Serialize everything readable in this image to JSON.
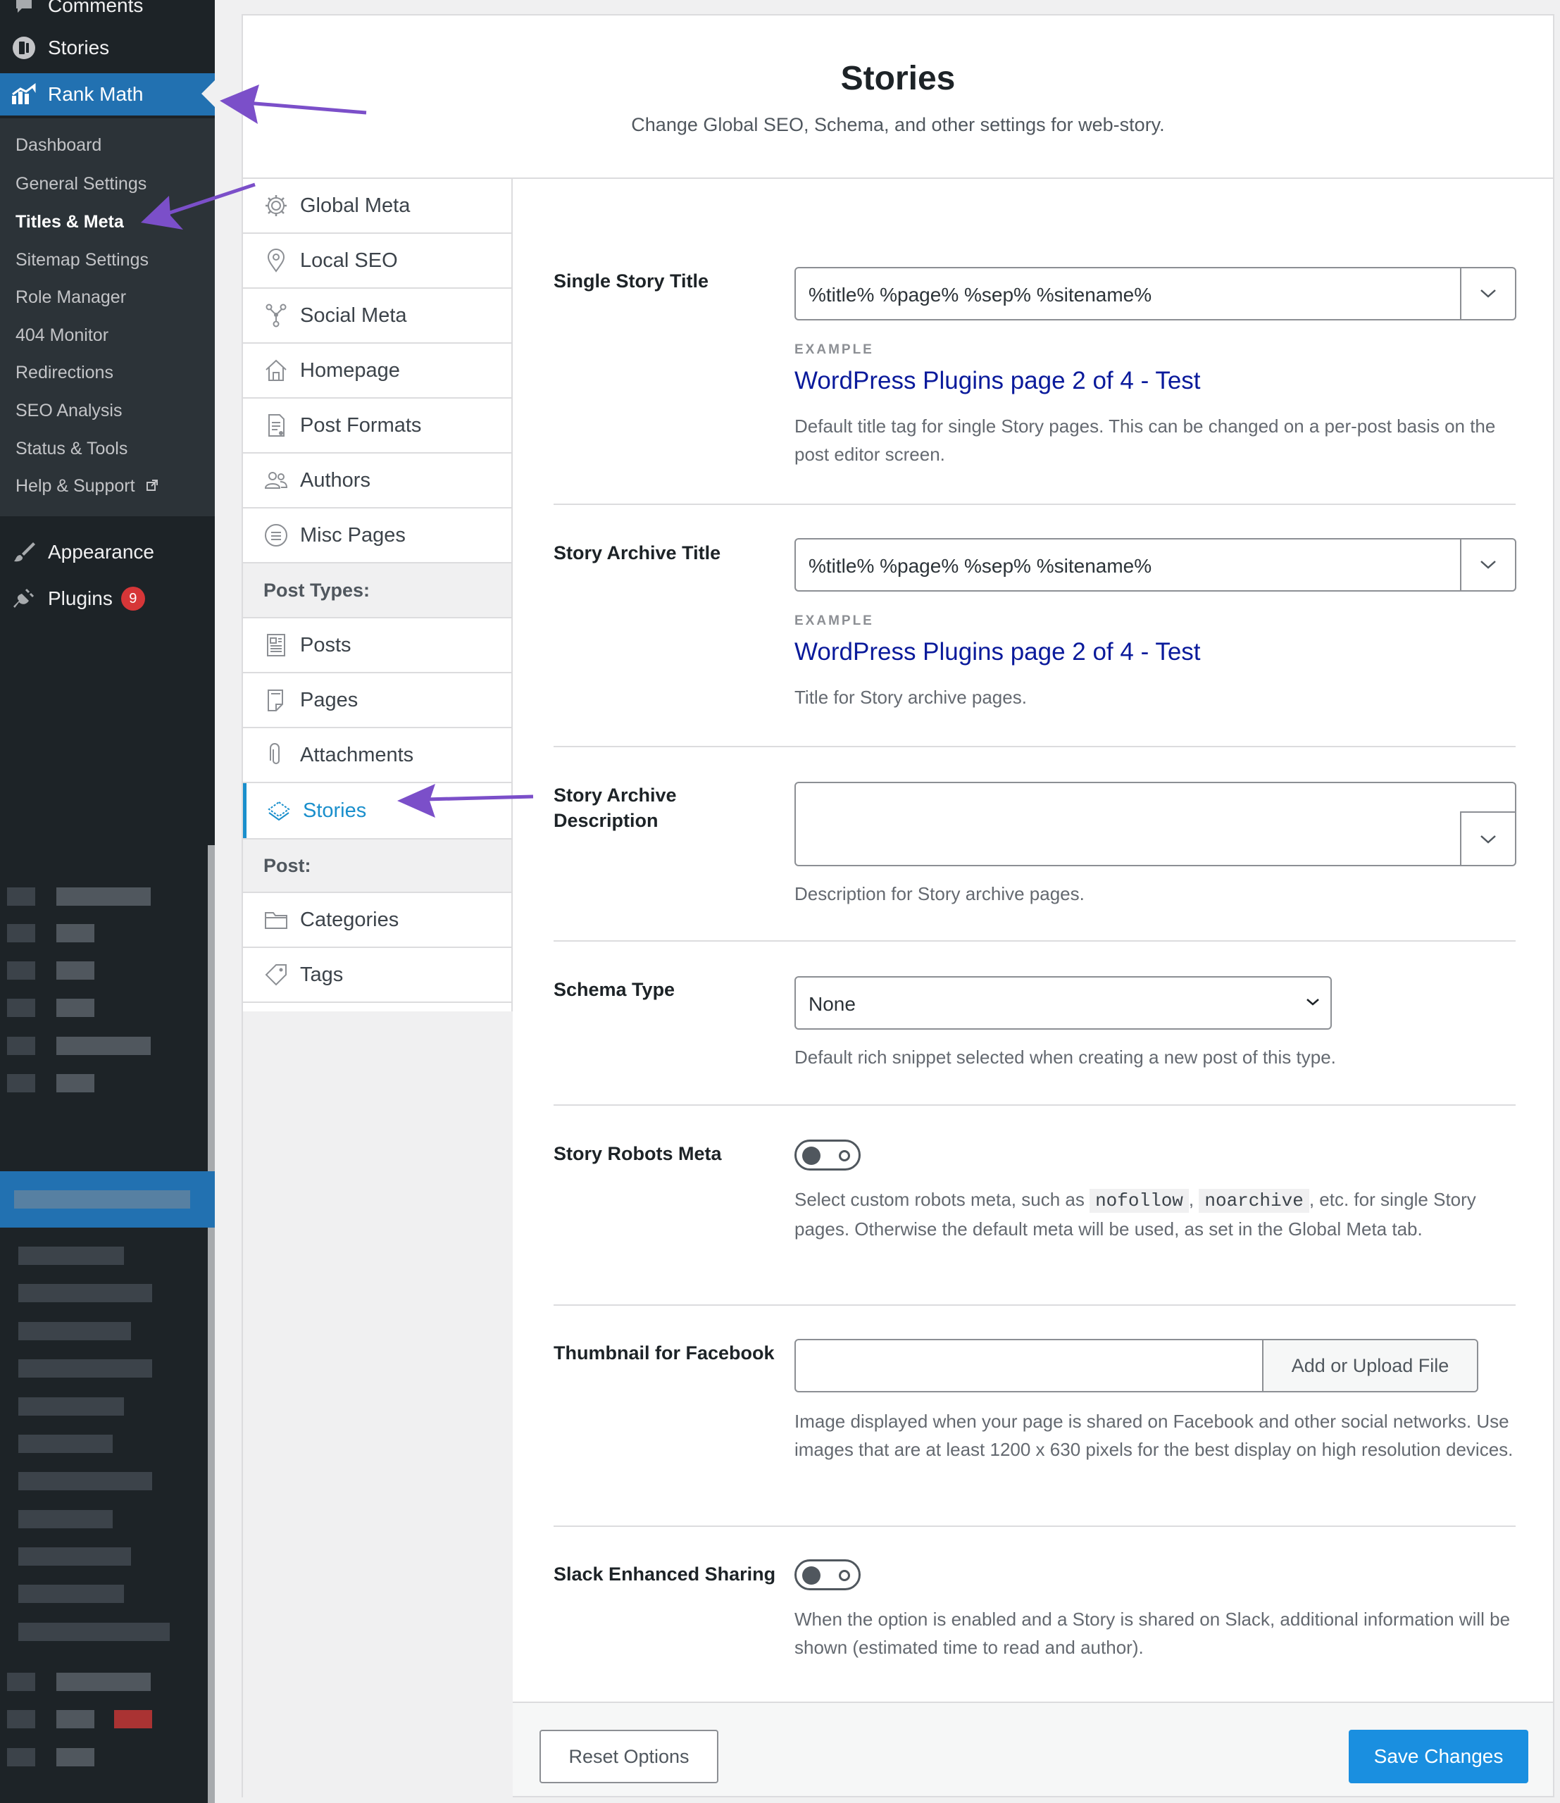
{
  "admin_menu": {
    "comments": "Comments",
    "stories": "Stories",
    "rank_math": "Rank Math",
    "submenu": [
      {
        "label": "Dashboard"
      },
      {
        "label": "General Settings"
      },
      {
        "label": "Titles & Meta",
        "active": true
      },
      {
        "label": "Sitemap Settings"
      },
      {
        "label": "Role Manager"
      },
      {
        "label": "404 Monitor"
      },
      {
        "label": "Redirections"
      },
      {
        "label": "SEO Analysis"
      },
      {
        "label": "Status & Tools"
      },
      {
        "label": "Help & Support"
      }
    ],
    "appearance": "Appearance",
    "plugins": "Plugins",
    "plugins_badge": "9"
  },
  "header": {
    "title": "Stories",
    "description": "Change Global SEO, Schema, and other settings for web-story."
  },
  "nav": {
    "items": [
      {
        "label": "Global Meta",
        "icon": "gear-icon"
      },
      {
        "label": "Local SEO",
        "icon": "location-pin-icon"
      },
      {
        "label": "Social Meta",
        "icon": "share-nodes-icon"
      },
      {
        "label": "Homepage",
        "icon": "home-icon"
      },
      {
        "label": "Post Formats",
        "icon": "document-icon"
      },
      {
        "label": "Authors",
        "icon": "users-icon"
      },
      {
        "label": "Misc Pages",
        "icon": "list-circle-icon"
      }
    ],
    "post_types_heading": "Post Types:",
    "post_types": [
      {
        "label": "Posts",
        "icon": "posts-icon"
      },
      {
        "label": "Pages",
        "icon": "pages-icon"
      },
      {
        "label": "Attachments",
        "icon": "paperclip-icon"
      },
      {
        "label": "Stories",
        "icon": "stories-icon",
        "active": true
      }
    ],
    "post_heading": "Post:",
    "post_taxonomies": [
      {
        "label": "Categories",
        "icon": "folder-icon"
      },
      {
        "label": "Tags",
        "icon": "tag-icon"
      }
    ]
  },
  "settings": {
    "single_title": {
      "label": "Single Story Title",
      "value": "%title% %page% %sep% %sitename%",
      "example_label": "EXAMPLE",
      "example": "WordPress Plugins page 2 of 4 - Test",
      "help": "Default title tag for single Story pages. This can be changed on a per-post basis on the post editor screen."
    },
    "archive_title": {
      "label": "Story Archive Title",
      "value": "%title% %page% %sep% %sitename%",
      "example_label": "EXAMPLE",
      "example": "WordPress Plugins page 2 of 4 - Test",
      "help": "Title for Story archive pages."
    },
    "archive_description": {
      "label": "Story Archive Description",
      "value": "",
      "help": "Description for Story archive pages."
    },
    "schema_type": {
      "label": "Schema Type",
      "value": "None",
      "help": "Default rich snippet selected when creating a new post of this type."
    },
    "robots_meta": {
      "label": "Story Robots Meta",
      "enabled": false,
      "help_before": "Select custom robots meta, such as ",
      "code1": "nofollow",
      "comma": ",",
      "code2": "noarchive",
      "help_after": ", etc. for single Story pages. Otherwise the default meta will be used, as set in the Global Meta tab."
    },
    "facebook_thumbnail": {
      "label": "Thumbnail for Facebook",
      "value": "",
      "button": "Add or Upload File",
      "help": "Image displayed when your page is shared on Facebook and other social networks. Use images that are at least 1200 x 630 pixels for the best display on high resolution devices."
    },
    "slack_sharing": {
      "label": "Slack Enhanced Sharing",
      "enabled": false,
      "help": "When the option is enabled and a Story is shared on Slack, additional information will be shown (estimated time to read and author)."
    }
  },
  "footer": {
    "reset": "Reset Options",
    "save": "Save Changes"
  },
  "colors": {
    "admin_bg": "#1d2327",
    "admin_current": "#2271b1",
    "accent": "#1a8fcc",
    "save_button": "#1a8fe0",
    "example_link": "#0a1a9b",
    "annotation_arrow": "#7b4fc9"
  }
}
